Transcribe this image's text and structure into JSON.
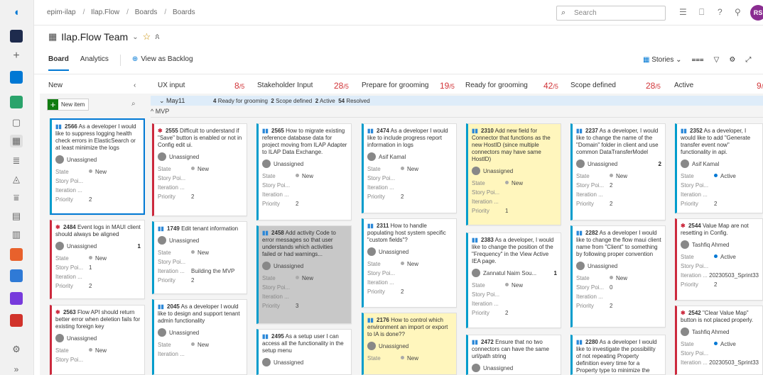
{
  "nav": {
    "breadcrumbs": [
      "epim-ilap",
      "Ilap.Flow",
      "Boards",
      "Boards"
    ],
    "search_placeholder": "Search",
    "avatar": "RS"
  },
  "team": {
    "name": "Ilap.Flow Team"
  },
  "tabs": {
    "board": "Board",
    "analytics": "Analytics",
    "view_backlog": "View as Backlog"
  },
  "controls": {
    "stories": "Stories"
  },
  "columns": [
    {
      "name": "New"
    },
    {
      "name": "UX input",
      "count": "8",
      "unit": "/5"
    },
    {
      "name": "Stakeholder Input",
      "count": "28",
      "unit": "/5"
    },
    {
      "name": "Prepare for grooming",
      "count": "19",
      "unit": "/5"
    },
    {
      "name": "Ready for grooming",
      "count": "42",
      "unit": "/5"
    },
    {
      "name": "Scope defined",
      "count": "28",
      "unit": "/5"
    },
    {
      "name": "Active",
      "count": "9",
      "unit": "/"
    }
  ],
  "new_item": "New item",
  "swimlane": {
    "name": "May11",
    "n1": "4",
    "s1": "Ready for grooming",
    "n2": "2",
    "s2": "Scope defined",
    "n3": "2",
    "s3": "Active",
    "n4": "54",
    "s4": "Resolved"
  },
  "mvp": "MVP",
  "labels": {
    "state": "State",
    "story": "Story Poi...",
    "iteration": "Iteration ...",
    "priority": "Priority"
  },
  "cards": [
    {
      "id": "2566",
      "title": "As a developer I would like to suppress logging health check errors in ElasticSearch or at least minimize the logs",
      "assignee": "Unassigned",
      "state": "New",
      "story": "",
      "iteration": "",
      "priority": "2"
    },
    {
      "id": "2484",
      "title": "Event logs in MAUI client should always be aligned",
      "assignee": "Unassigned",
      "badge": "1",
      "state": "New",
      "story": "1",
      "iteration": "",
      "priority": "2"
    },
    {
      "id": "2563",
      "title": "Flow API should return better error when deletion fails for existing foreign key",
      "assignee": "Unassigned",
      "state": "New",
      "story": ""
    },
    {
      "id": "2555",
      "title": "Difficult to understand if \"Save\" button is enabled or not in Config edit ui.",
      "assignee": "Unassigned",
      "state": "New",
      "story": "",
      "iteration": "",
      "priority": "2"
    },
    {
      "id": "1749",
      "title": "Edit tenant information",
      "assignee": "Unassigned",
      "state": "New",
      "story": "",
      "iteration": "Building the MVP",
      "priority": "2"
    },
    {
      "id": "2045",
      "title": "As a developer I would like to design and support tenant admin functionality",
      "assignee": "Unassigned",
      "state": "New",
      "iteration": ""
    },
    {
      "id": "2565",
      "title": "How to migrate existing reference database data for project moving from ILAP Adapter to ILAP Data Exchange.",
      "assignee": "Unassigned",
      "state": "New",
      "story": "",
      "iteration": "",
      "priority": "2"
    },
    {
      "id": "2458",
      "title": "Add activity Code to error messages so that user understands which activities failed or had warnings...",
      "assignee": "Unassigned",
      "state": "New",
      "story": "",
      "iteration": "",
      "priority": "3"
    },
    {
      "id": "2495",
      "title": "As a setup user I can access all the functionality in the setup menu",
      "assignee": "Unassigned"
    },
    {
      "id": "2474",
      "title": "As a developer I would like to include progress report information in logs",
      "assignee": "Asif Kamal",
      "state": "New",
      "story": "",
      "iteration": "",
      "priority": "2"
    },
    {
      "id": "2311",
      "title": "How to handle populating host system specific \"custom fields\"?",
      "assignee": "Unassigned",
      "state": "New",
      "story": "",
      "iteration": "",
      "priority": "2"
    },
    {
      "id": "2176",
      "title": "How to control which environment an import or export to IA is done??",
      "assignee": "Unassigned",
      "state": "New"
    },
    {
      "id": "2310",
      "title": "Add new field for Connector that functions as the new HostID (since multiple connectors may have same HostID)",
      "assignee": "Unassigned",
      "state": "New",
      "story": "",
      "iteration": "",
      "priority": "1"
    },
    {
      "id": "2383",
      "title": "As a developer, I would like to change the position of the \"Frequency\" in the View Active IEA page.",
      "assignee": "Zannatul Naim Sou...",
      "badge": "1",
      "state": "New",
      "story": "",
      "iteration": "",
      "priority": "2"
    },
    {
      "id": "2472",
      "title": "Ensure that no two connectors can have the same url/path string",
      "assignee": "Unassigned"
    },
    {
      "id": "2237",
      "title": "As a developer, I would like to change the name of the \"Domain\" folder in client and use common DataTransferModel",
      "assignee": "Unassigned",
      "badge": "2",
      "state": "New",
      "story": "2",
      "iteration": "",
      "priority": "2"
    },
    {
      "id": "2282",
      "title": "As a developer I would like to change the flow maui client name from \"Client\" to something by following proper convention",
      "assignee": "Unassigned",
      "state": "New",
      "story": "0",
      "iteration": "",
      "priority": "2"
    },
    {
      "id": "2280",
      "title": "As a developer I would like to investigate the possibility of not repeating Property definition every time for a Property type to minimize the",
      "assignee": ""
    },
    {
      "id": "2352",
      "title": "As a developer, I would like to add \"Generate transfer event now\" functionality in api.",
      "assignee": "Asif Kamal",
      "state": "Active",
      "story": "",
      "iteration": "",
      "priority": "2"
    },
    {
      "id": "2544",
      "title": "Value Map are not resetting in Config.",
      "assignee": "Tashfiq Ahmed",
      "state": "Active",
      "story": "",
      "iteration": "20230503_Sprint33",
      "priority": "2"
    },
    {
      "id": "2542",
      "title": "\"Clear Value Map\" button is not placed properly.",
      "assignee": "Tashfiq Ahmed",
      "state": "Active",
      "story": "",
      "iteration": "20230503_Sprint33"
    }
  ]
}
